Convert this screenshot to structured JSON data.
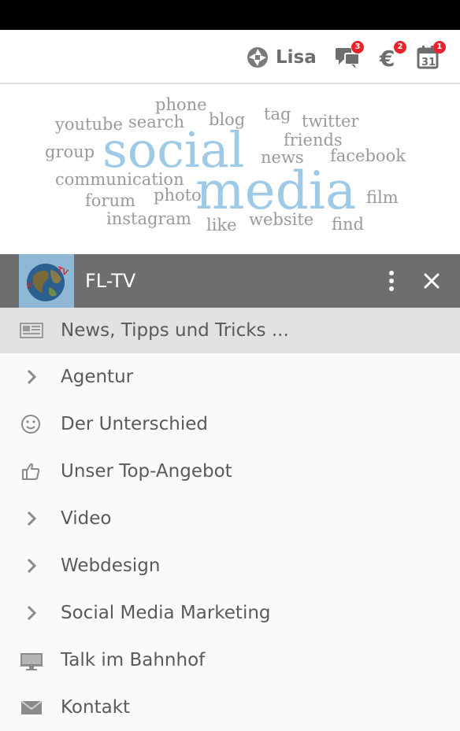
{
  "topbar": {
    "user_name": "Lisa",
    "messages_badge": "3",
    "euro_badge": "2",
    "calendar_badge": "1",
    "calendar_day": "31"
  },
  "banner": {
    "words": [
      "phone",
      "youtube",
      "search",
      "blog",
      "tag",
      "twitter",
      "friends",
      "group",
      "social",
      "news",
      "facebook",
      "communication",
      "media",
      "forum",
      "photo",
      "film",
      "instagram",
      "website",
      "like",
      "find"
    ]
  },
  "drawer": {
    "title": "FL-TV",
    "logo_text": "FL-TV"
  },
  "menu": [
    {
      "label": "News, Tipps und Tricks ...",
      "icon": "newspaper-icon"
    },
    {
      "label": "Agentur",
      "icon": "chevron-right-icon"
    },
    {
      "label": "Der Unterschied",
      "icon": "smiley-icon"
    },
    {
      "label": "Unser Top-Angebot",
      "icon": "thumbs-up-icon"
    },
    {
      "label": "Video",
      "icon": "chevron-right-icon"
    },
    {
      "label": "Webdesign",
      "icon": "chevron-right-icon"
    },
    {
      "label": "Social Media Marketing",
      "icon": "chevron-right-icon"
    },
    {
      "label": "Talk im Bahnhof",
      "icon": "monitor-icon"
    },
    {
      "label": "Kontakt",
      "icon": "envelope-icon"
    }
  ],
  "colors": {
    "header_gray": "#6e6e6e",
    "badge_red": "#e8232b",
    "wordcloud_blue": "#9ecae8",
    "wordcloud_gray": "#9a9a9a"
  }
}
